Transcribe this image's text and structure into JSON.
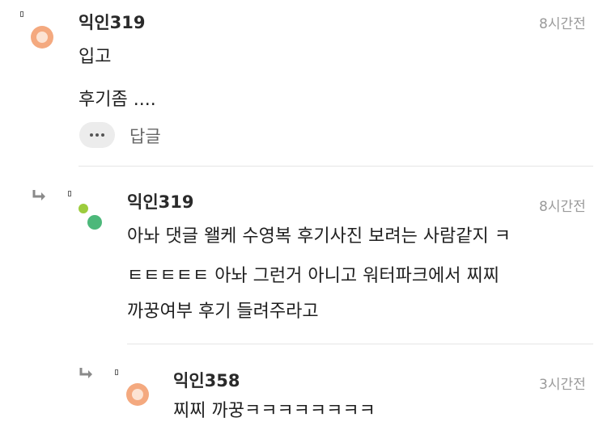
{
  "comments": [
    {
      "nickname": "익인319",
      "time": "8시간전",
      "lines": [
        "입고",
        "후기좀 ...."
      ],
      "reply_label": "답글",
      "avatar_color": "#f4a97f"
    },
    {
      "nickname": "익인319",
      "time": "8시간전",
      "lines": [
        "아놔 댓글 왤케 수영복 후기사진 보려는 사람같지 ㅋ",
        "ㅌㅌㅌㅌㅌ 아놔 그런거 아니고 워터파크에서 찌찌",
        "까꿍여부 후기 들려주라고"
      ],
      "avatar_colors": [
        "#9ccc3d",
        "#4cb87a"
      ]
    },
    {
      "nickname": "익인358",
      "time": "3시간전",
      "lines": [
        "찌찌 까꿍ㅋㅋㅋㅋㅋㅋㅋㅋ"
      ],
      "avatar_color": "#f4a97f"
    }
  ],
  "icons": {
    "pin": "pin-icon",
    "reply_arrow": "reply-arrow-icon",
    "more": "more-dots-icon"
  },
  "colors": {
    "divider": "#e6e6e6",
    "time": "#9a9a9a"
  }
}
